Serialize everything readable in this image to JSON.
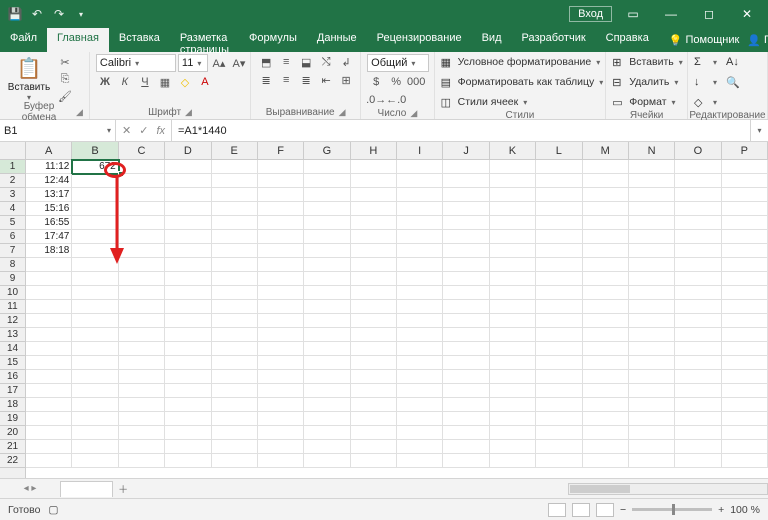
{
  "titlebar": {
    "login": "Вход"
  },
  "tabs": {
    "items": [
      "Файл",
      "Главная",
      "Вставка",
      "Разметка страницы",
      "Формулы",
      "Данные",
      "Рецензирование",
      "Вид",
      "Разработчик",
      "Справка"
    ],
    "active": 1,
    "help": "Помощник",
    "share": "Поделиться"
  },
  "ribbon": {
    "clipboard": {
      "paste": "Вставить",
      "label": "Буфер обмена"
    },
    "font": {
      "name": "Calibri",
      "size": "11",
      "label": "Шрифт"
    },
    "align": {
      "label": "Выравнивание"
    },
    "number": {
      "format": "Общий",
      "label": "Число"
    },
    "styles": {
      "cond": "Условное форматирование",
      "table": "Форматировать как таблицу",
      "cell": "Стили ячеек",
      "label": "Стили"
    },
    "cells": {
      "insert": "Вставить",
      "delete": "Удалить",
      "format": "Формат",
      "label": "Ячейки"
    },
    "editing": {
      "label": "Редактирование"
    }
  },
  "fbar": {
    "name": "B1",
    "formula": "=A1*1440"
  },
  "grid": {
    "cols": [
      "A",
      "B",
      "C",
      "D",
      "E",
      "F",
      "G",
      "H",
      "I",
      "J",
      "K",
      "L",
      "M",
      "N",
      "O",
      "P"
    ],
    "selected_col": 1,
    "selected_row": 0,
    "rows": 22,
    "data": {
      "A": [
        "11:12",
        "12:44",
        "13:17",
        "15:16",
        "16:55",
        "17:47",
        "18:18"
      ],
      "B": [
        "672"
      ]
    }
  },
  "sheet": {
    "add": "＋"
  },
  "status": {
    "ready": "Готово",
    "zoom": "100 %"
  }
}
